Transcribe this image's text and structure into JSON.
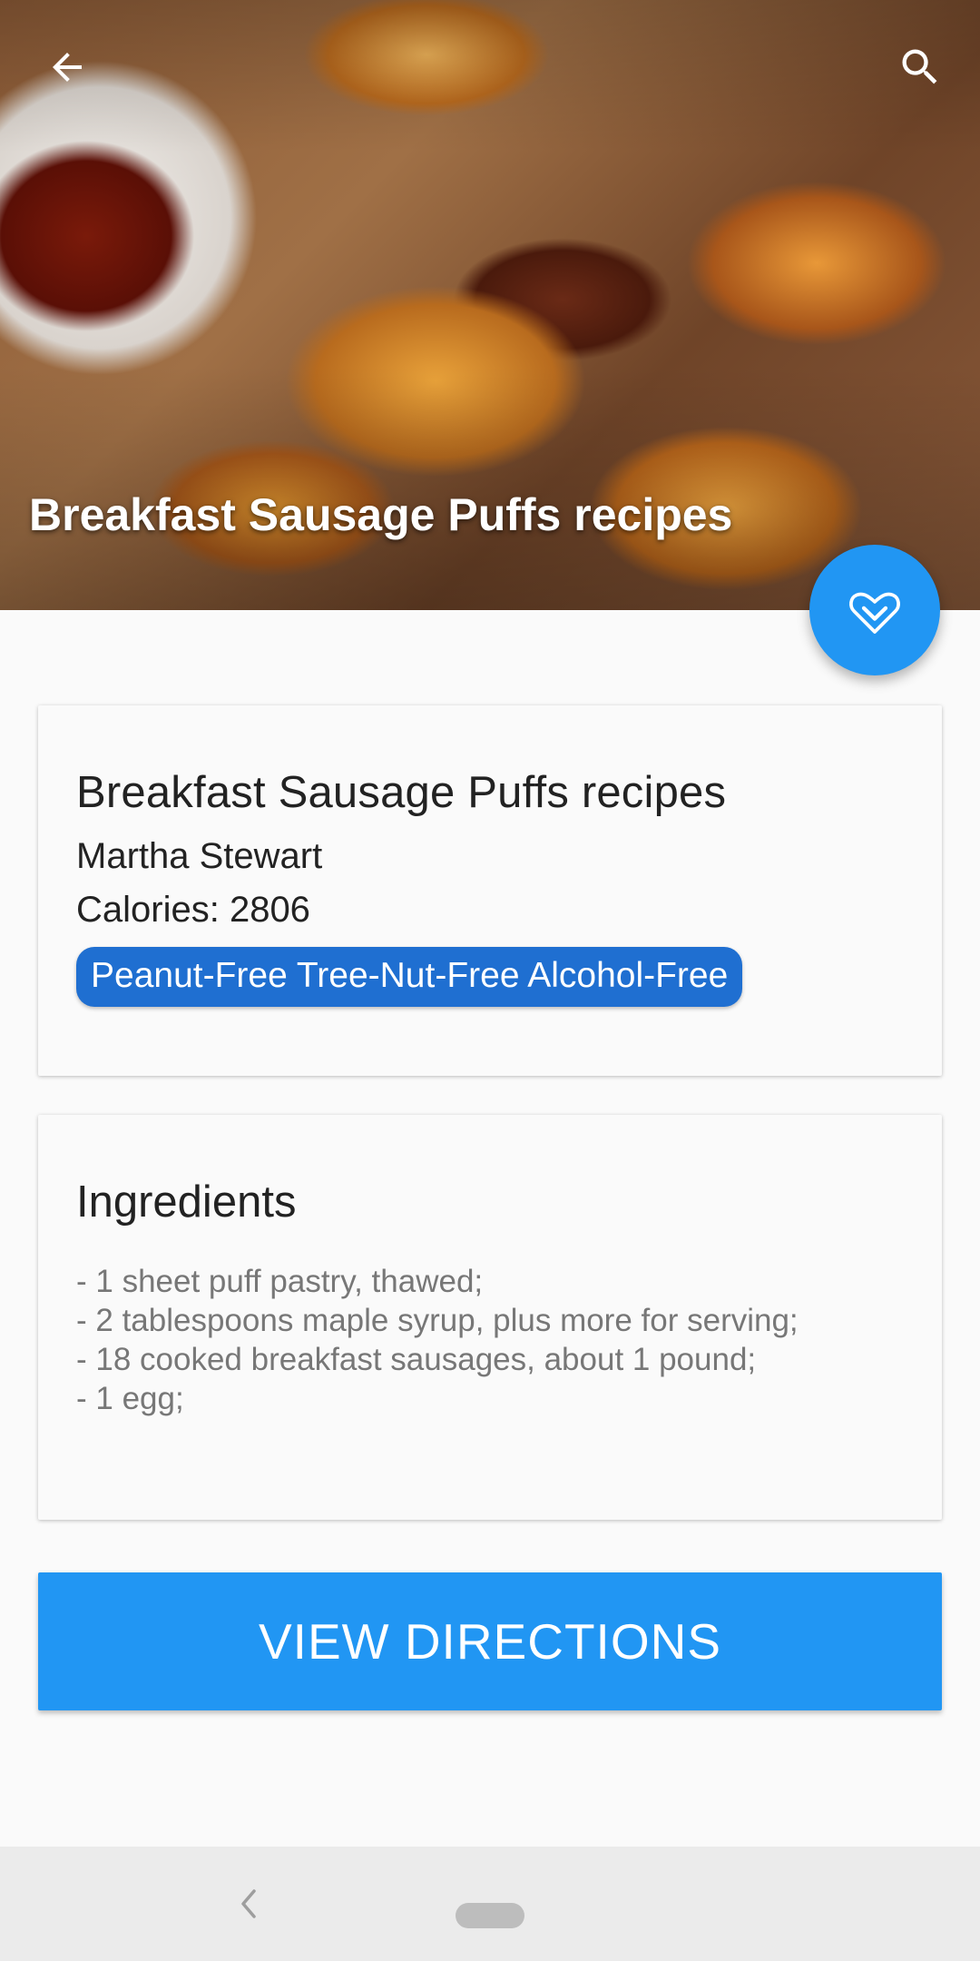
{
  "hero": {
    "title": "Breakfast Sausage Puffs recipes",
    "icons": {
      "back": "arrow-back-icon",
      "search": "search-icon"
    }
  },
  "fab": {
    "icon": "favorite-check-icon",
    "color": "#2196f3"
  },
  "info_card": {
    "title": "Breakfast Sausage Puffs recipes",
    "author": "Martha Stewart",
    "calories": "Calories: 2806",
    "labels": "Peanut-Free Tree-Nut-Free Alcohol-Free"
  },
  "ingredients_card": {
    "title": "Ingredients",
    "items": [
      "- 1 sheet puff pastry, thawed;",
      "- 2 tablespoons maple syrup, plus more for serving;",
      "- 18 cooked breakfast sausages, about 1 pound;",
      "- 1 egg;"
    ]
  },
  "actions": {
    "view_directions": "VIEW DIRECTIONS"
  },
  "colors": {
    "accent": "#2196f3",
    "chip": "#1f6fd1",
    "background": "#fafafa"
  },
  "navbar": {
    "icons": {
      "back": "nav-back-icon",
      "home": "nav-home-pill"
    }
  }
}
